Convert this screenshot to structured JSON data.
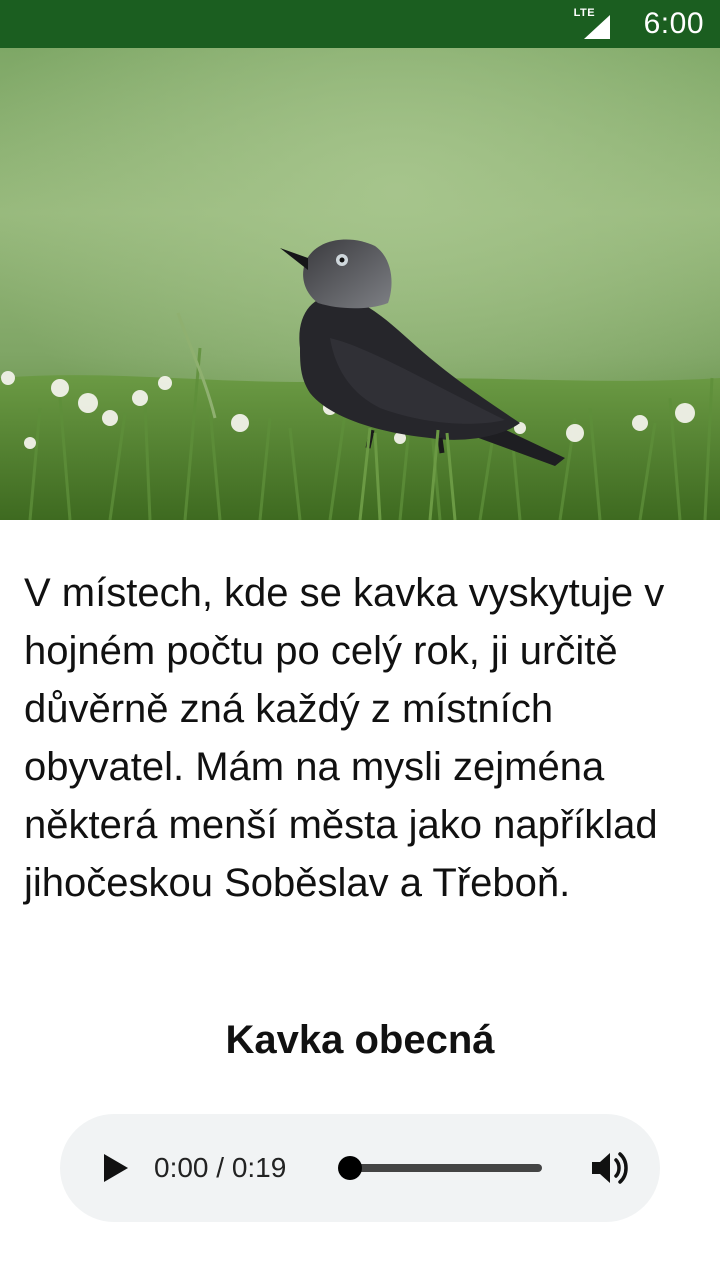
{
  "status_bar": {
    "network_label": "LTE",
    "signal_icon": "signal-bars-icon",
    "time": "6:00",
    "background": "#1b5e20"
  },
  "hero_image": {
    "description_icon": "jackdaw-photo"
  },
  "article": {
    "text": "V místech, kde se kavka vyskytuje v hojném počtu po celý rok, ji určitě důvěrně zná každý z místních obyvatel. Mám na mysli zejména některá menší města jako například jihočeskou Soběslav a Třeboň."
  },
  "caption": {
    "title": "Kavka obecná"
  },
  "audio_player": {
    "play_icon": "play-icon",
    "time_readout": "0:00 / 0:19",
    "progress": 0,
    "volume_icon": "volume-icon"
  }
}
